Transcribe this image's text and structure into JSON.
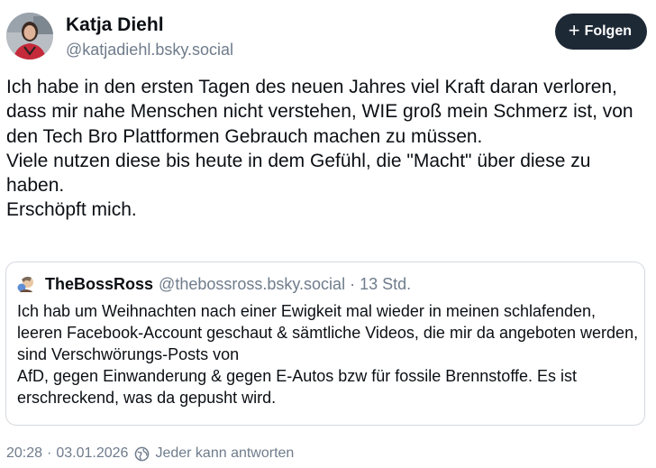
{
  "author": {
    "name": "Katja Diehl",
    "handle": "@katjadiehl.bsky.social",
    "follow_label": "Folgen",
    "follow_icon": "plus-icon"
  },
  "post": {
    "paragraphs": [
      "Ich habe in den ersten Tagen des neuen Jahres viel Kraft daran verloren, dass mir nahe Menschen nicht verstehen, WIE groß mein Schmerz ist, von den Tech Bro Plattformen Gebrauch machen zu müssen.",
      "Viele nutzen diese bis heute in dem Gefühl, die \"Macht\" über diese zu haben.",
      "Erschöpft mich."
    ]
  },
  "quote": {
    "name": "TheBossRoss",
    "handle": "@thebossross.bsky.social",
    "separator": "·",
    "time": "13 Std.",
    "lines": [
      "Ich hab um Weihnachten nach einer Ewigkeit mal wieder in meinen schlafenden, leeren Facebook-Account geschaut & sämtliche Videos, die mir da angeboten werden, sind Verschwörungs-Posts von",
      "AfD, gegen Einwanderung & gegen E-Autos bzw für fossile Brennstoffe. Es ist erschreckend, was da gepusht wird."
    ]
  },
  "footer": {
    "time": "20:28",
    "separator": "·",
    "date": "03.01.2026",
    "reply_icon": "globe-reply-icon",
    "reply_setting": "Jeder kann antworten"
  },
  "colors": {
    "text": "#0b0f14",
    "muted": "#6f7c8c",
    "button_bg": "#1e2936",
    "border": "#d4d9de"
  }
}
